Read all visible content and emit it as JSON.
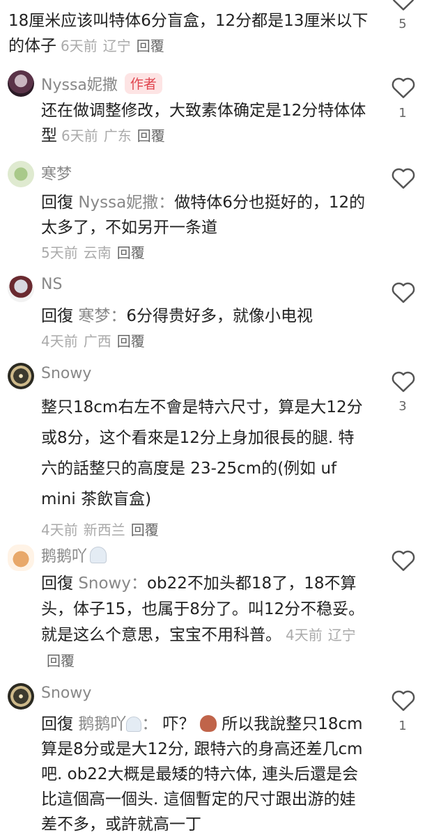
{
  "comments": [
    {
      "id": "c0",
      "text": "18厘米应该叫特体6分盲盒，12分都是13厘米以下的体子",
      "time": "6天前",
      "region": "辽宁",
      "reply": "回覆",
      "likes": "5"
    },
    {
      "id": "c1",
      "user": "Nyssa妮撒",
      "badge": "作者",
      "text": "还在做调整修改，大致素体确定是12分特体体型",
      "time": "6天前",
      "region": "广东",
      "reply": "回覆",
      "likes": "1"
    },
    {
      "id": "c2",
      "user": "寒梦",
      "reply_prefix": "回復",
      "mention": "Nyssa妮撒：",
      "text": "做特体6分也挺好的，12的太多了，不如另开一条道",
      "time": "5天前",
      "region": "云南",
      "reply": "回覆",
      "likes": ""
    },
    {
      "id": "c3",
      "user": "NS",
      "reply_prefix": "回復",
      "mention": "寒梦：",
      "text": "6分得贵好多，就像小电视",
      "time": "4天前",
      "region": "广西",
      "reply": "回覆",
      "likes": ""
    },
    {
      "id": "c4",
      "user": "Snowy",
      "text": "整只18cm右左不會是特六尺寸，算是大12分或8分，这个看來是12分上身加很長的腿. 特六的話整只的高度是 23-25cm的(例如 uf mini 茶飲盲盒)",
      "time": "4天前",
      "region": "新西兰",
      "reply": "回覆",
      "likes": "3"
    },
    {
      "id": "c5",
      "user": "鹅鹅吖",
      "reply_prefix": "回復",
      "mention": "Snowy：",
      "text": "ob22不加头都18了，18不算头，体子15，也属于8分了。叫12分不稳妥。就是这么个意思，宝宝不用科普。",
      "time": "4天前",
      "region": "辽宁",
      "reply": "回覆",
      "likes": ""
    },
    {
      "id": "c6",
      "user": "Snowy",
      "reply_prefix": "回復",
      "mention": "鹅鹅吖",
      "mention_suffix": "：",
      "text_a": "吓？",
      "text_b": "所以我說整只18cm算是8分或是大12分, 跟特六的身高还差几cm吧. ob22大概是最矮的特六体, 連头后還是会比這個高一個头. 這個暫定的尺寸跟出游的娃差不多，或許就高一丁",
      "likes": "1"
    }
  ],
  "colors": {
    "badge_bg": "#fde4e4",
    "badge_text": "#e0454f",
    "meta": "#aaaaaa"
  }
}
